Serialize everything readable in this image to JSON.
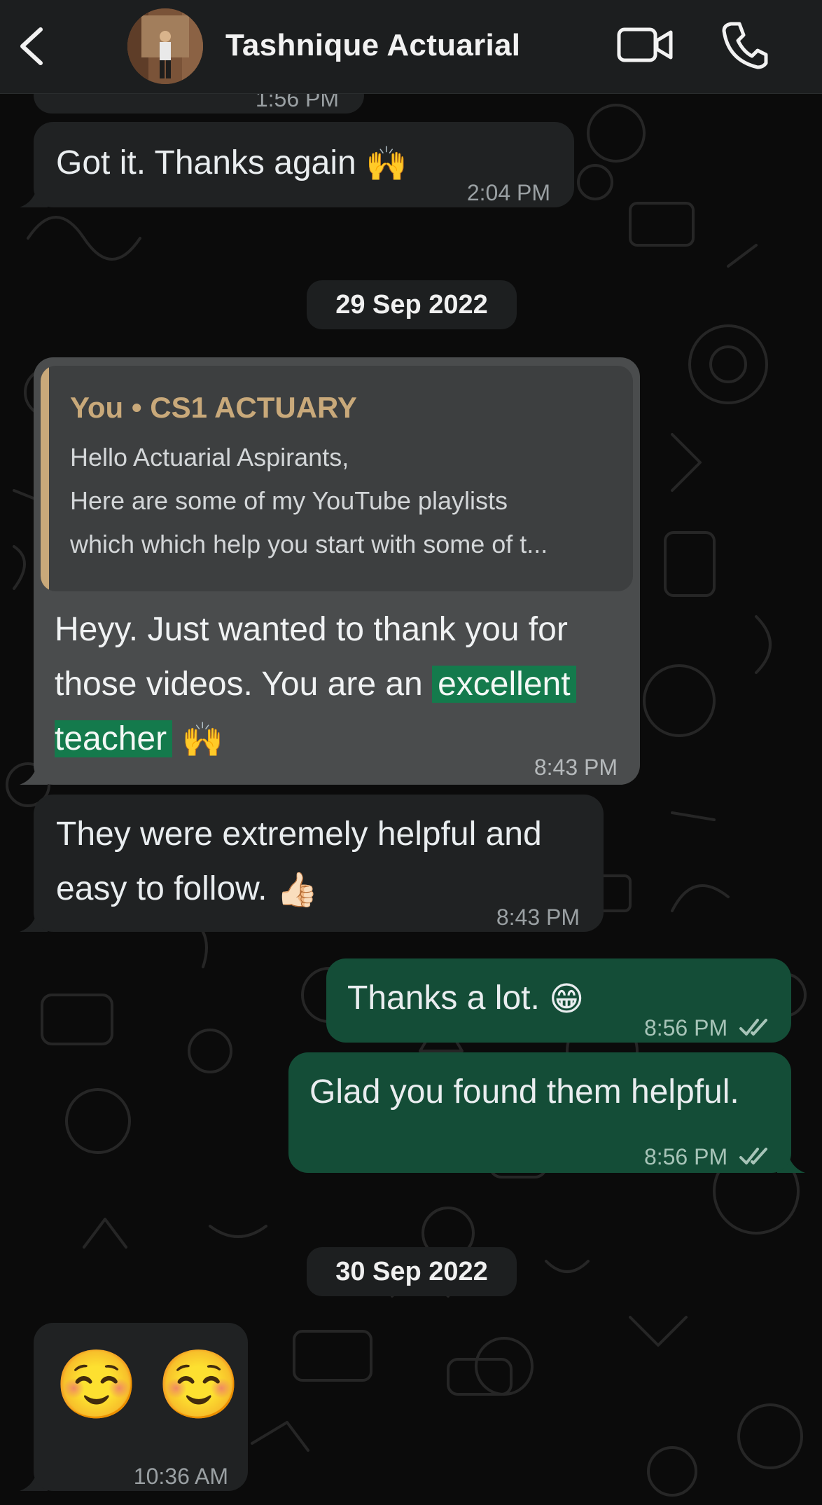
{
  "header": {
    "contact_name": "Tashnique Actuarial"
  },
  "icons": {
    "back": "chevron-left-icon",
    "video": "video-camera-icon",
    "call": "phone-icon"
  },
  "colors": {
    "incoming_bubble": "#202223",
    "outgoing_bubble": "#144d37",
    "highlight": "#147a4c",
    "quote_accent": "#c9a97a"
  },
  "messages": {
    "m0_time_partial": "1:56 PM",
    "m1": {
      "text": "Got it. Thanks again",
      "emoji": "🙌",
      "time": "2:04 PM"
    },
    "date1": "29 Sep 2022",
    "m2": {
      "quote_author": "You • CS1 ACTUARY",
      "quote_line1": "Hello Actuarial Aspirants,",
      "quote_line2": "Here are some of my YouTube playlists",
      "quote_line3": "which which help you start with some of t...",
      "line1": "Heyy. Just wanted to thank you for",
      "line2_a": "those videos. You are an",
      "line2_hl": "excellent",
      "line3_hl": "teacher",
      "emoji": "🙌",
      "time": "8:43 PM"
    },
    "m3": {
      "line1": "They were extremely helpful and",
      "line2": "easy to follow.",
      "emoji": "👍🏻",
      "time": "8:43 PM"
    },
    "m4": {
      "text": "Thanks a lot.",
      "emoji": "😁",
      "time": "8:56 PM",
      "status": "read"
    },
    "m5": {
      "text": "Glad you found them helpful.",
      "time": "8:56 PM",
      "status": "read"
    },
    "date2": "30 Sep 2022",
    "m6": {
      "emoji": "☺️ ☺️",
      "time": "10:36 AM"
    }
  }
}
